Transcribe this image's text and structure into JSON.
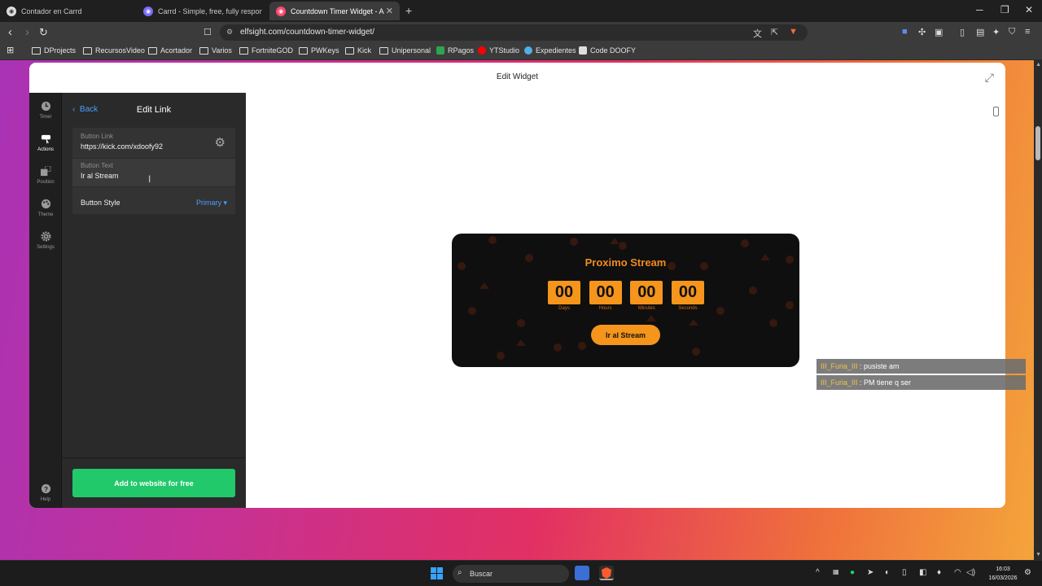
{
  "browser": {
    "tabs": [
      {
        "title": "Contador en Carrd",
        "active": false
      },
      {
        "title": "Carrd - Simple, free, fully responsive",
        "active": false
      },
      {
        "title": "Countdown Timer Widget - Add",
        "active": true
      }
    ],
    "url": "elfsight.com/countdown-timer-widget/",
    "bookmarks": [
      "DProjects",
      "RecursosVideo",
      "Acortador",
      "Varios",
      "FortniteGOD",
      "PWKeys",
      "Kick",
      "Unipersonal",
      "RPagos",
      "YTStudio",
      "Expedientes",
      "Code DOOFY"
    ]
  },
  "modal": {
    "title": "Edit Widget"
  },
  "rail": {
    "items": [
      {
        "label": "Timer",
        "active": false
      },
      {
        "label": "Actions",
        "active": true
      },
      {
        "label": "Position",
        "active": false
      },
      {
        "label": "Theme",
        "active": false
      },
      {
        "label": "Settings",
        "active": false
      },
      {
        "label": "Help",
        "active": false
      }
    ]
  },
  "panel": {
    "back_label": "Back",
    "title": "Edit Link",
    "button_link_label": "Button Link",
    "button_link_value": "https://kick.com/xdoofy92",
    "button_text_label": "Button Text",
    "button_text_value": "Ir al Stream",
    "button_style_label": "Button Style",
    "button_style_value": "Primary",
    "cta_label": "Add to website for free"
  },
  "widget": {
    "title": "Proximo Stream",
    "units": [
      {
        "value": "00",
        "label": "Days"
      },
      {
        "value": "00",
        "label": "Hours"
      },
      {
        "value": "00",
        "label": "Minutes"
      },
      {
        "value": "00",
        "label": "Seconds"
      }
    ],
    "button_label": "Ir al Stream",
    "accent_color": "#f5951c"
  },
  "chat": [
    {
      "user": "III_Furia_III",
      "message": " : pusiste am"
    },
    {
      "user": "III_Furia_III",
      "message": " : PM tiene q ser"
    }
  ],
  "taskbar": {
    "search_placeholder": "Buscar",
    "time": "16:03",
    "date": "16/03/2026"
  }
}
